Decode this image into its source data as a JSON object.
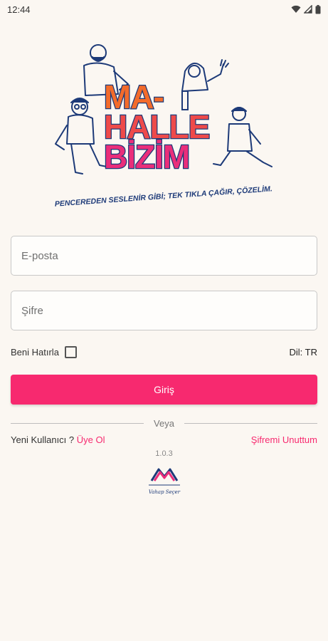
{
  "status_bar": {
    "time": "12:44",
    "icons": [
      "wifi-icon",
      "signal-icon",
      "battery-icon"
    ]
  },
  "hero": {
    "logo_lines": [
      "MA-",
      "HALLE",
      "BİZİM"
    ],
    "tagline": "PENCEREDEN SESLENİR GİBİ; TEK TIKLA ÇAĞIR, ÇÖZELİM."
  },
  "form": {
    "email_placeholder": "E-posta",
    "password_placeholder": "Şifre",
    "remember_label": "Beni Hatırla",
    "remember_checked": false,
    "language_label": "Dil: TR",
    "login_label": "Giriş"
  },
  "divider": {
    "text": "Veya"
  },
  "links": {
    "new_user_text": "Yeni Kullanıcı ?",
    "register_label": "Üye Ol",
    "forgot_label": "Şifremi Unuttum"
  },
  "footer": {
    "version": "1.0.3",
    "logo_text": "Vahap Seçer"
  },
  "colors": {
    "accent": "#f7296f",
    "background": "#fbf7f2",
    "navy": "#1d3a78",
    "orange": "#f36b2b"
  }
}
